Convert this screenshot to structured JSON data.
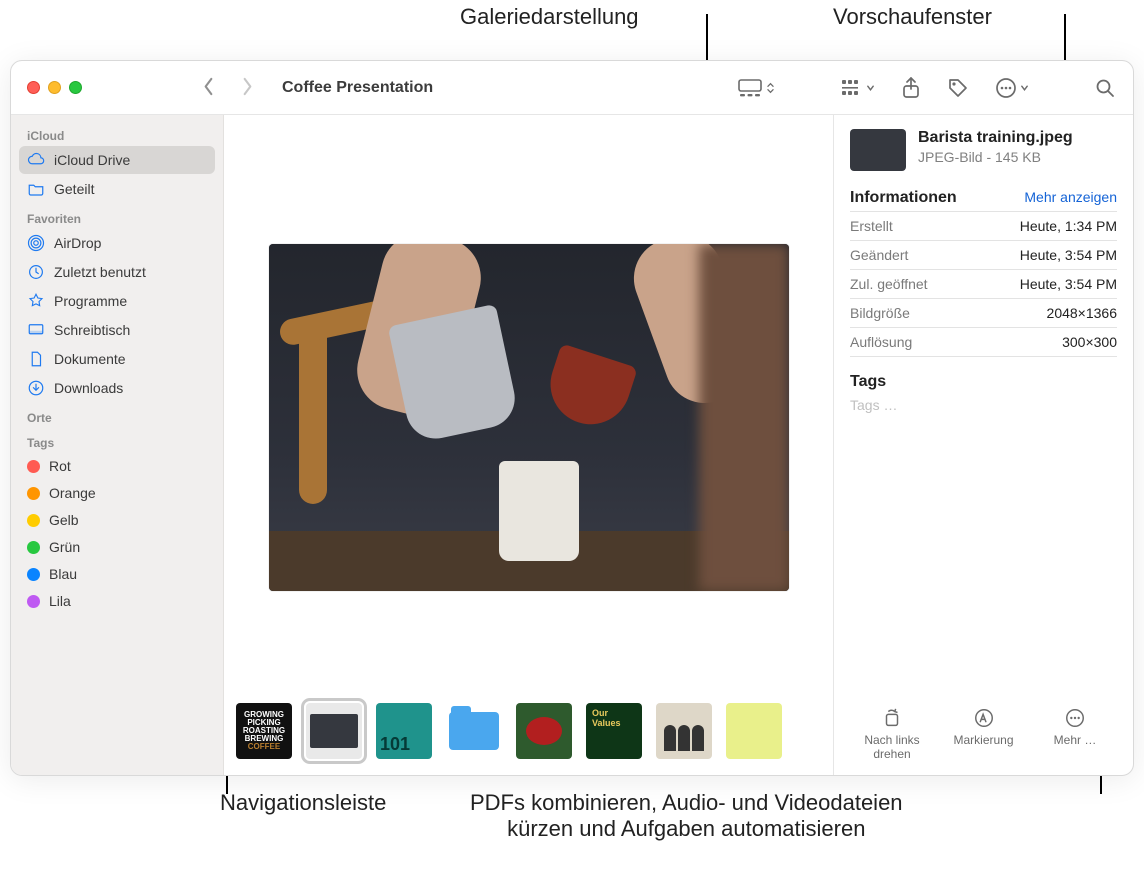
{
  "callouts": {
    "gallery": "Galeriedarstellung",
    "preview_pane": "Vorschaufenster",
    "nav_bar": "Navigationsleiste",
    "more_actions": "PDFs kombinieren, Audio- und Videodateien\nkürzen und Aufgaben automatisieren"
  },
  "toolbar": {
    "title": "Coffee Presentation"
  },
  "sidebar": {
    "icloud_header": "iCloud",
    "icloud": [
      {
        "label": "iCloud Drive",
        "selected": true
      },
      {
        "label": "Geteilt",
        "selected": false
      }
    ],
    "fav_header": "Favoriten",
    "favorites": [
      {
        "label": "AirDrop"
      },
      {
        "label": "Zuletzt benutzt"
      },
      {
        "label": "Programme"
      },
      {
        "label": "Schreibtisch"
      },
      {
        "label": "Dokumente"
      },
      {
        "label": "Downloads"
      }
    ],
    "places_header": "Orte",
    "tags_header": "Tags",
    "tags": [
      {
        "label": "Rot",
        "color": "#ff5b52"
      },
      {
        "label": "Orange",
        "color": "#ff9500"
      },
      {
        "label": "Gelb",
        "color": "#ffcc00"
      },
      {
        "label": "Grün",
        "color": "#28c840"
      },
      {
        "label": "Blau",
        "color": "#0a84ff"
      },
      {
        "label": "Lila",
        "color": "#bf5af2"
      }
    ]
  },
  "inspector": {
    "filename": "Barista training.jpeg",
    "subtitle": "JPEG-Bild - 145 KB",
    "info_header": "Informationen",
    "more": "Mehr anzeigen",
    "rows": [
      {
        "k": "Erstellt",
        "v": "Heute, 1:34 PM"
      },
      {
        "k": "Geändert",
        "v": "Heute, 3:54 PM"
      },
      {
        "k": "Zul. geöffnet",
        "v": "Heute, 3:54 PM"
      },
      {
        "k": "Bildgröße",
        "v": "2048×1366"
      },
      {
        "k": "Auflösung",
        "v": "300×300"
      }
    ],
    "tags_header": "Tags",
    "tags_placeholder": "Tags …",
    "actions": {
      "rotate": "Nach links drehen",
      "markup": "Markierung",
      "more": "Mehr …"
    }
  },
  "thumbs": {
    "t1_lines": [
      "GROWING",
      "PICKING",
      "ROASTING",
      "BREWING"
    ],
    "t1_coffee": "COFFEE",
    "t3_num": "101",
    "t6_our": "Our",
    "t6_values": "Values"
  }
}
